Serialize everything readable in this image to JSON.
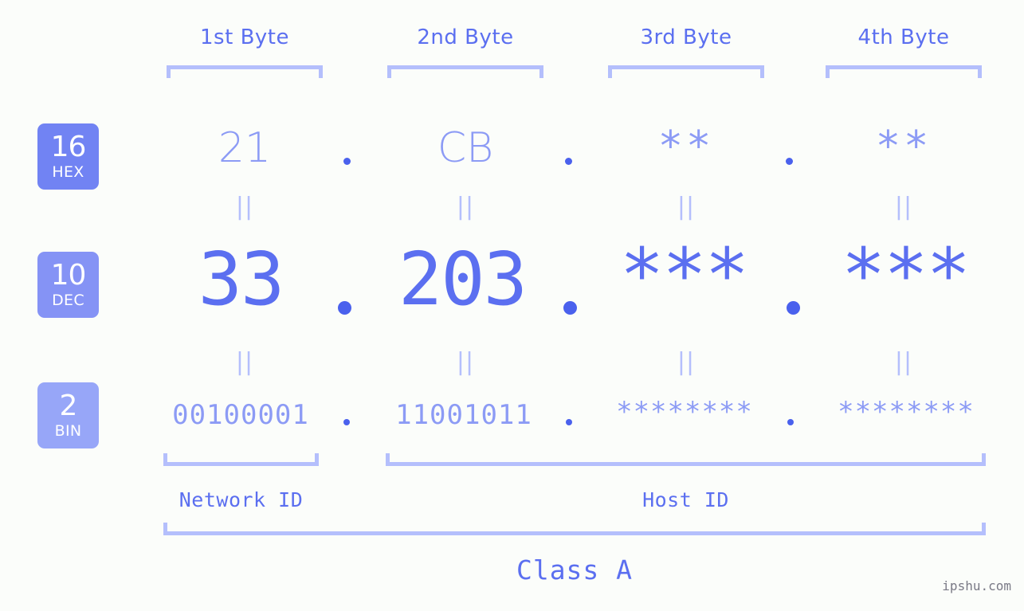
{
  "meta": {
    "background_color": "#fbfdfa",
    "accent_strong": "#4a61ed",
    "accent_mid": "#5b6ff0",
    "accent_light": "#8c9bf5",
    "accent_pale": "#b4bffc",
    "watermark": "ipshu.com"
  },
  "byte_headers": [
    {
      "label": "1st Byte"
    },
    {
      "label": "2nd Byte"
    },
    {
      "label": "3rd Byte"
    },
    {
      "label": "4th Byte"
    }
  ],
  "bases": [
    {
      "number": "16",
      "name": "HEX",
      "color": "#7183f3"
    },
    {
      "number": "10",
      "name": "DEC",
      "color": "#8593f5"
    },
    {
      "number": "2",
      "name": "BIN",
      "color": "#97a6f8"
    }
  ],
  "rows": {
    "hex": {
      "base_number": "16",
      "base_name": "HEX",
      "values": [
        "21",
        "CB",
        "**",
        "**"
      ],
      "separator": "."
    },
    "dec": {
      "base_number": "10",
      "base_name": "DEC",
      "values": [
        "33",
        "203",
        "***",
        "***"
      ],
      "separator": "."
    },
    "bin": {
      "base_number": "2",
      "base_name": "BIN",
      "values": [
        "00100001",
        "11001011",
        "********",
        "********"
      ],
      "separator": "."
    }
  },
  "equals_marks": {
    "glyph": "||",
    "count_per_row": 4,
    "rows": 2
  },
  "sections": [
    {
      "label": "Network ID"
    },
    {
      "label": "Host ID"
    }
  ],
  "class": {
    "label": "Class A"
  }
}
